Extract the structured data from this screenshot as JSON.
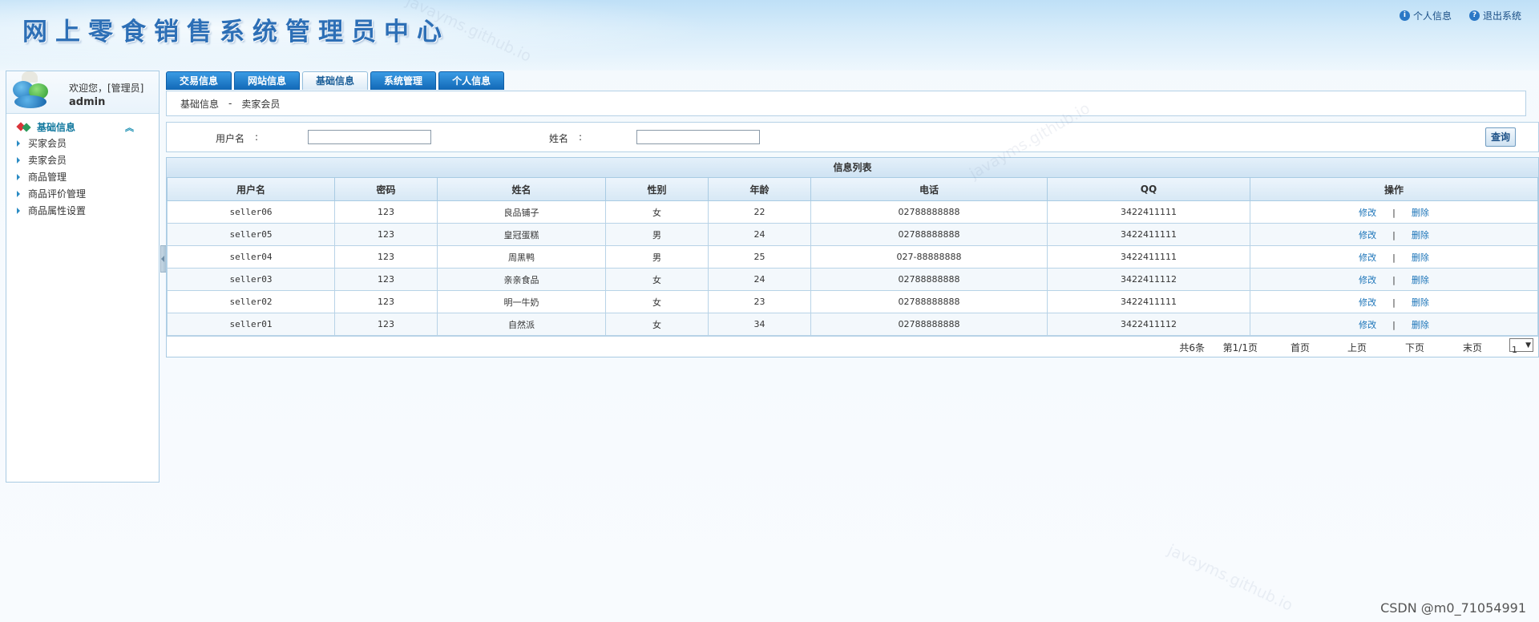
{
  "header": {
    "title": "网上零食销售系统管理员中心",
    "links": [
      {
        "label": "个人信息",
        "icon": "user-info-icon"
      },
      {
        "label": "退出系统",
        "icon": "help-exit-icon"
      }
    ]
  },
  "sidebar": {
    "welcome": "欢迎您，[管理员]",
    "username": "admin",
    "menu_title": "基础信息",
    "items": [
      {
        "label": "买家会员"
      },
      {
        "label": "卖家会员"
      },
      {
        "label": "商品管理"
      },
      {
        "label": "商品评价管理"
      },
      {
        "label": "商品属性设置"
      }
    ]
  },
  "tabs": [
    {
      "label": "交易信息"
    },
    {
      "label": "网站信息"
    },
    {
      "label": "基础信息",
      "active": true
    },
    {
      "label": "系统管理"
    },
    {
      "label": "个人信息"
    }
  ],
  "breadcrumb": {
    "section": "基础信息",
    "separator": "-",
    "page": "卖家会员"
  },
  "search": {
    "username_label": "用户名",
    "name_label": "姓名",
    "colon": ":",
    "username_value": "",
    "name_value": "",
    "query_label": "查询"
  },
  "table": {
    "caption": "信息列表",
    "columns": [
      "用户名",
      "密码",
      "姓名",
      "性别",
      "年龄",
      "电话",
      "QQ",
      "操作"
    ],
    "rows": [
      {
        "username": "seller06",
        "password": "123",
        "name": "良品铺子",
        "gender": "女",
        "age": "22",
        "phone": "02788888888",
        "qq": "3422411111"
      },
      {
        "username": "seller05",
        "password": "123",
        "name": "皇冠蛋糕",
        "gender": "男",
        "age": "24",
        "phone": "02788888888",
        "qq": "3422411111"
      },
      {
        "username": "seller04",
        "password": "123",
        "name": "周黑鸭",
        "gender": "男",
        "age": "25",
        "phone": "027-88888888",
        "qq": "3422411111"
      },
      {
        "username": "seller03",
        "password": "123",
        "name": "亲亲食品",
        "gender": "女",
        "age": "24",
        "phone": "02788888888",
        "qq": "3422411112"
      },
      {
        "username": "seller02",
        "password": "123",
        "name": "明一牛奶",
        "gender": "女",
        "age": "23",
        "phone": "02788888888",
        "qq": "3422411111"
      },
      {
        "username": "seller01",
        "password": "123",
        "name": "自然派",
        "gender": "女",
        "age": "34",
        "phone": "02788888888",
        "qq": "3422411112"
      }
    ],
    "actions": {
      "edit": "修改",
      "separator": "|",
      "delete": "删除"
    }
  },
  "pager": {
    "total": "共6条",
    "page_info": "第1/1页",
    "first": "首页",
    "prev": "上页",
    "next": "下页",
    "last": "末页",
    "select_value": "1",
    "dropdown_glyph": "▼"
  },
  "watermarks": [
    "javayms.github.io"
  ],
  "credit": "CSDN @m0_71054991",
  "colors": {
    "accent": "#2d6fb6",
    "tab": "#1168b6",
    "link": "#1a73b8",
    "border": "#a9cbe3"
  }
}
